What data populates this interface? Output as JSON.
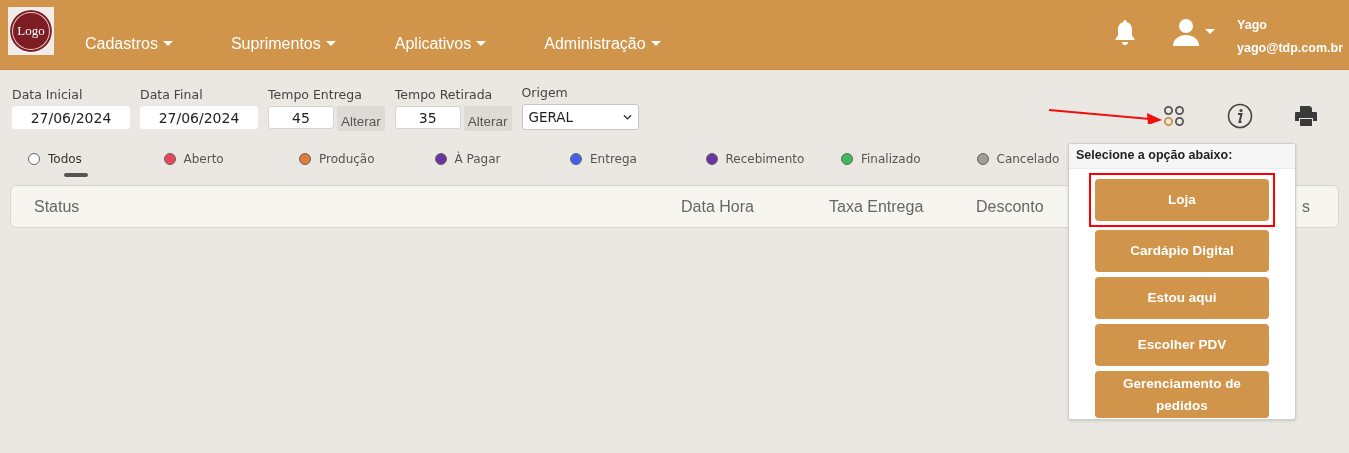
{
  "navbar": {
    "logo_text": "Logo",
    "menus": [
      {
        "label": "Cadastros"
      },
      {
        "label": "Suprimentos"
      },
      {
        "label": "Aplicativos"
      },
      {
        "label": "Administração"
      }
    ],
    "user": {
      "name": "Yago",
      "email": "yago@tdp.com.br"
    }
  },
  "filters": [
    {
      "kind": "date",
      "label": "Data Inicial",
      "value": "27/06/2024"
    },
    {
      "kind": "date",
      "label": "Data Final",
      "value": "27/06/2024"
    },
    {
      "kind": "time",
      "label": "Tempo Entrega",
      "value": "45",
      "button": "Alterar"
    },
    {
      "kind": "time",
      "label": "Tempo Retirada",
      "value": "35",
      "button": "Alterar"
    },
    {
      "kind": "select",
      "label": "Origem",
      "value": "GERAL"
    }
  ],
  "status_tabs": [
    {
      "label": "Todos",
      "color": "#ffffff",
      "selected": true
    },
    {
      "label": "Aberto",
      "color": "#e8475e",
      "selected": false
    },
    {
      "label": "Produção",
      "color": "#e07b3a",
      "selected": false
    },
    {
      "label": "À Pagar",
      "color": "#6a35a3",
      "selected": false
    },
    {
      "label": "Entrega",
      "color": "#4361ee",
      "selected": false
    },
    {
      "label": "Recebimento",
      "color": "#6a35a3",
      "selected": false
    },
    {
      "label": "Finalizado",
      "color": "#3dbb5a",
      "selected": false
    },
    {
      "label": "Cancelado",
      "color": "#a09c98",
      "selected": false
    }
  ],
  "table": {
    "columns": [
      "Status",
      "Data Hora",
      "Taxa Entrega",
      "Desconto",
      "s"
    ]
  },
  "popover": {
    "title": "Selecione a opção abaixo:",
    "options": [
      {
        "label": "Loja",
        "highlighted": true
      },
      {
        "label": "Cardápio Digital",
        "highlighted": false
      },
      {
        "label": "Estou aqui",
        "highlighted": false
      },
      {
        "label": "Escolher PDV",
        "highlighted": false
      },
      {
        "label": "Gerenciamento de pedidos",
        "highlighted": false
      }
    ]
  },
  "annotation_arrow": true
}
